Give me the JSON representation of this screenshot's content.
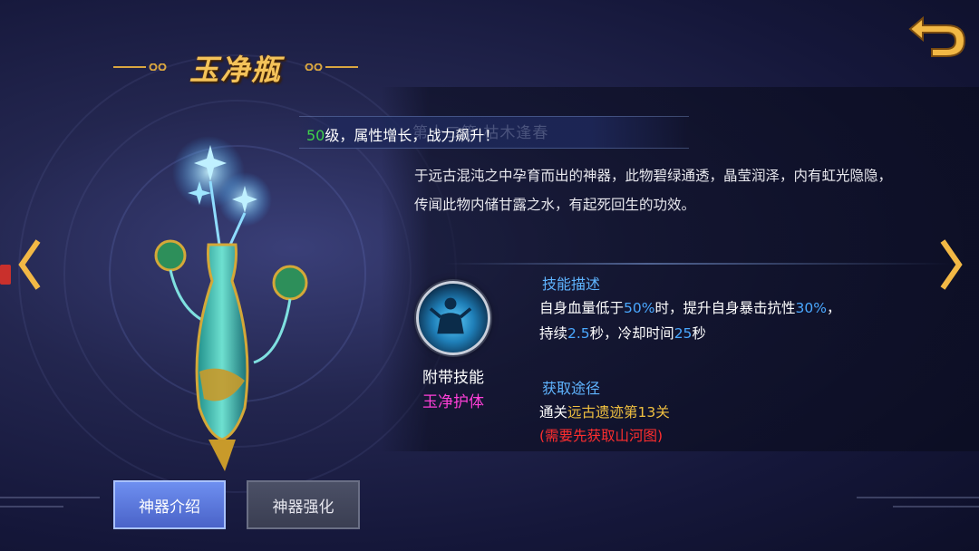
{
  "artifact": {
    "name": "玉净瓶",
    "level_line": {
      "level": "50",
      "text": "级，属性增长，战力飙升！",
      "ghost_text": "第十二篇 枯木逢春"
    },
    "description": "于远古混沌之中孕育而出的神器，此物碧绿通透，晶莹润泽，内有虹光隐隐，传闻此物内储甘露之水，有起死回生的功效。"
  },
  "skill": {
    "caption": "附带技能",
    "name": "玉净护体",
    "icon": "meditating-figure-icon",
    "desc_heading": "技能描述",
    "desc_line1_pre": "自身血量低于",
    "desc_hp_pct": "50%",
    "desc_line1_mid": "时，提升自身暴击抗性",
    "desc_crit_pct": "30%",
    "desc_line1_post": "，",
    "desc_line2_pre": "持续",
    "desc_duration": "2.5",
    "desc_line2_mid": "秒，冷却时间",
    "desc_cooldown": "25",
    "desc_line2_post": "秒"
  },
  "obtain": {
    "heading": "获取途径",
    "prefix": "通关",
    "location": "远古遗迹第13关",
    "requirement": "(需要先获取山河图)"
  },
  "tabs": {
    "intro": "神器介绍",
    "enhance": "神器强化"
  },
  "colors": {
    "title_gold": "#f4c35a",
    "level_green": "#3fd24a",
    "highlight_blue": "#4aa8ff",
    "skill_pink": "#ff3fd8",
    "location_gold": "#f0c040",
    "requirement_red": "#ff2e2e"
  }
}
